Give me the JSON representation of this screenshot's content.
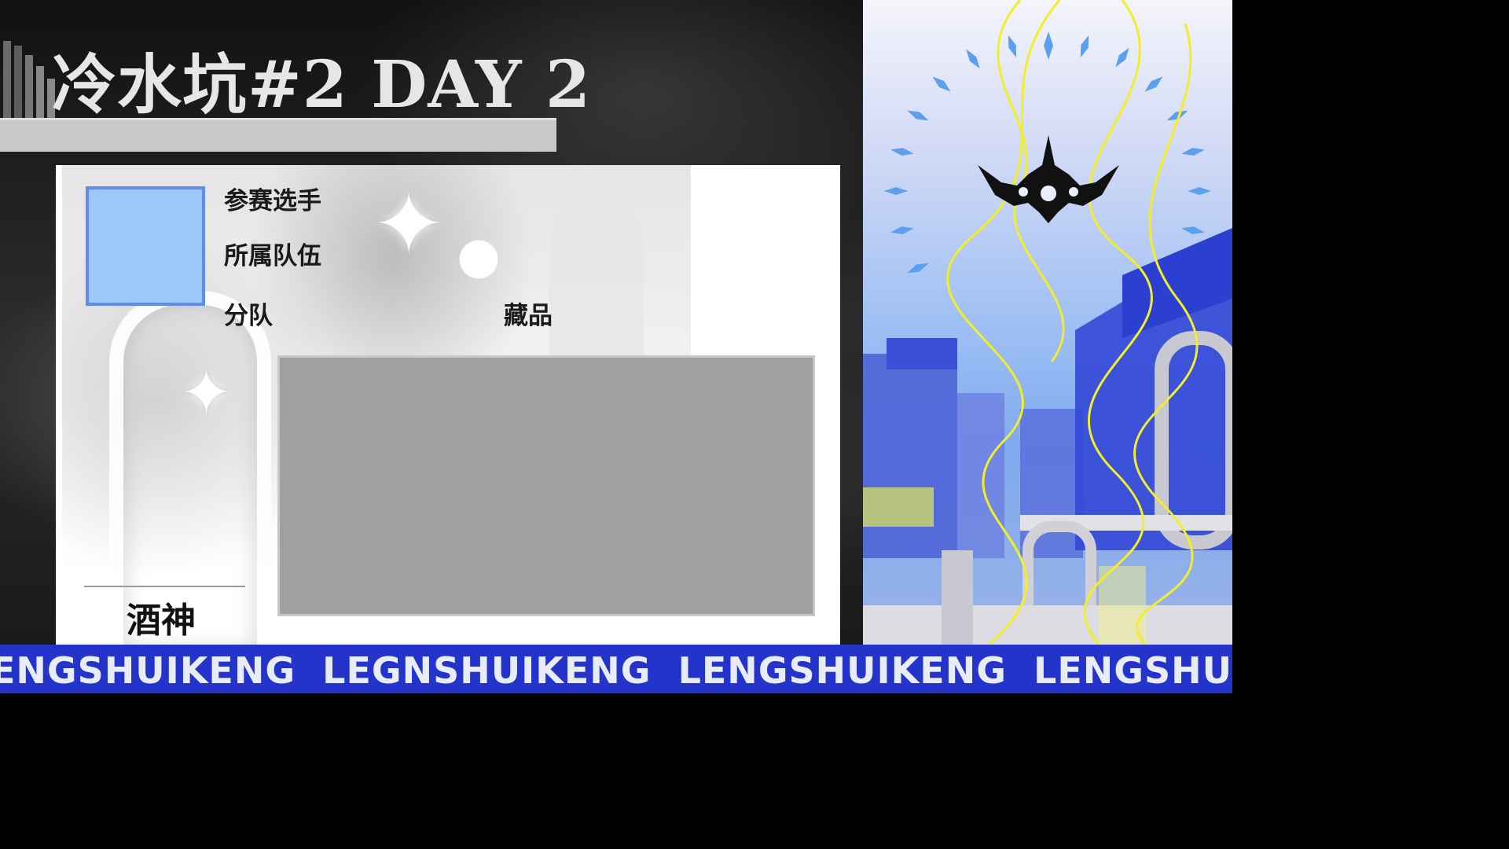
{
  "header": {
    "title": "冷水坑#2 DAY 2"
  },
  "card": {
    "labels": {
      "player": "参赛选手",
      "team": "所属队伍",
      "squad": "分队",
      "collection": "藏品"
    },
    "player_name": "酒神"
  },
  "ticker": {
    "text": "ENGSHUIKENG  LEGNSHUIKENG  LENGSHUIKENG  LENGSHUIE"
  },
  "colors": {
    "avatar_fill": "#9cc8f8",
    "avatar_border": "#5b8ef0",
    "ticker_bg": "#2433c9",
    "poster_accent": "#3a4fd8",
    "poster_line": "#f2ee2a"
  },
  "icons": [
    "crown-emblem-icon",
    "sparkle-icon"
  ]
}
